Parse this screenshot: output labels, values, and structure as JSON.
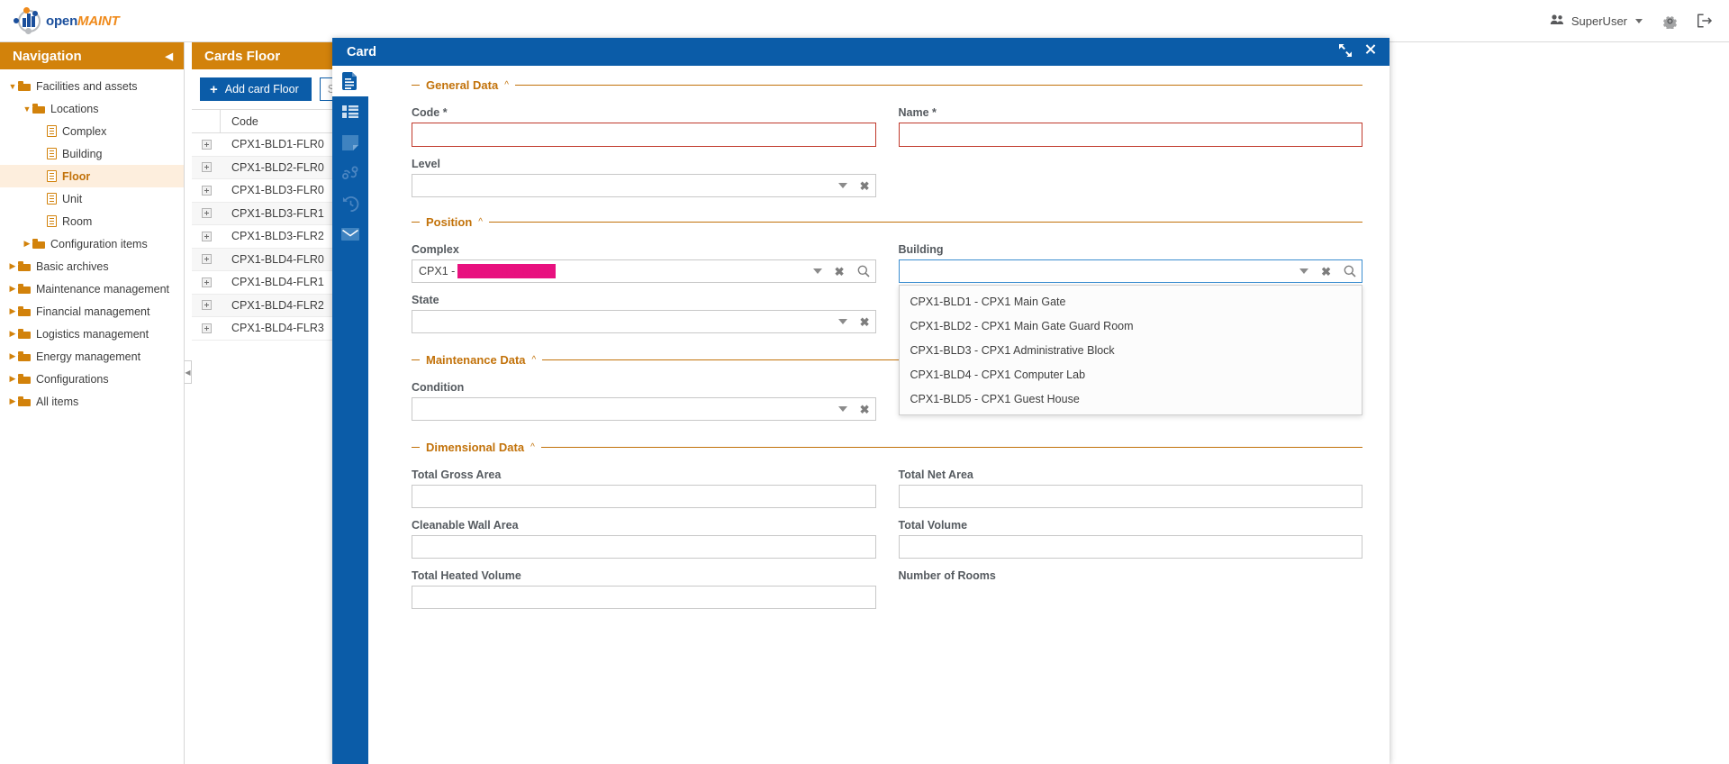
{
  "topbar": {
    "logo_open": "open",
    "logo_maint": "MAINT",
    "user": "SuperUser",
    "icons": {
      "users": "users-icon",
      "settings": "gear-icon",
      "logout": "logout-icon"
    }
  },
  "navigation": {
    "title": "Navigation",
    "collapse_icon": "collapse-left-icon",
    "items": [
      {
        "label": "Facilities and assets",
        "type": "folder",
        "indent": 0,
        "expanded": true,
        "active": false
      },
      {
        "label": "Locations",
        "type": "folder",
        "indent": 1,
        "expanded": true,
        "active": false
      },
      {
        "label": "Complex",
        "type": "doc",
        "indent": 2,
        "expanded": null,
        "active": false
      },
      {
        "label": "Building",
        "type": "doc",
        "indent": 2,
        "expanded": null,
        "active": false
      },
      {
        "label": "Floor",
        "type": "doc",
        "indent": 2,
        "expanded": null,
        "active": true
      },
      {
        "label": "Unit",
        "type": "doc",
        "indent": 2,
        "expanded": null,
        "active": false
      },
      {
        "label": "Room",
        "type": "doc",
        "indent": 2,
        "expanded": null,
        "active": false
      },
      {
        "label": "Configuration items",
        "type": "folder",
        "indent": 1,
        "expanded": false,
        "active": false
      },
      {
        "label": "Basic archives",
        "type": "folder",
        "indent": 0,
        "expanded": false,
        "active": false
      },
      {
        "label": "Maintenance management",
        "type": "folder",
        "indent": 0,
        "expanded": false,
        "active": false
      },
      {
        "label": "Financial management",
        "type": "folder",
        "indent": 0,
        "expanded": false,
        "active": false
      },
      {
        "label": "Logistics management",
        "type": "folder",
        "indent": 0,
        "expanded": false,
        "active": false
      },
      {
        "label": "Energy management",
        "type": "folder",
        "indent": 0,
        "expanded": false,
        "active": false
      },
      {
        "label": "Configurations",
        "type": "folder",
        "indent": 0,
        "expanded": false,
        "active": false
      },
      {
        "label": "All items",
        "type": "folder",
        "indent": 0,
        "expanded": false,
        "active": false
      }
    ]
  },
  "cards": {
    "title": "Cards Floor",
    "add_button": "Add card Floor",
    "search_placeholder": "Search...",
    "column_header": "Code",
    "rows": [
      "CPX1-BLD1-FLR0",
      "CPX1-BLD2-FLR0",
      "CPX1-BLD3-FLR0",
      "CPX1-BLD3-FLR1",
      "CPX1-BLD3-FLR2",
      "CPX1-BLD4-FLR0",
      "CPX1-BLD4-FLR1",
      "CPX1-BLD4-FLR2",
      "CPX1-BLD4-FLR3"
    ]
  },
  "card_modal": {
    "title": "Card",
    "expand_icon": "expand-icon",
    "close_icon": "close-icon",
    "rail": [
      {
        "name": "card-details-icon",
        "active": true
      },
      {
        "name": "details-list-icon",
        "active": false
      },
      {
        "name": "notes-icon",
        "active": false
      },
      {
        "name": "relations-icon",
        "active": false
      },
      {
        "name": "history-icon",
        "active": false
      },
      {
        "name": "email-icon",
        "active": false
      }
    ],
    "sections": {
      "general": {
        "title": "General Data",
        "code_label": "Code *",
        "code_value": "",
        "name_label": "Name *",
        "name_value": "",
        "level_label": "Level",
        "level_value": ""
      },
      "position": {
        "title": "Position",
        "complex_label": "Complex",
        "complex_value": "CPX1 - ",
        "complex_redacted": "REDACTEDNAME",
        "building_label": "Building",
        "building_value": "",
        "state_label": "State",
        "state_value": "",
        "building_options": [
          "CPX1-BLD1 - CPX1 Main Gate",
          "CPX1-BLD2 - CPX1 Main Gate Guard Room",
          "CPX1-BLD3 - CPX1 Administrative Block",
          "CPX1-BLD4 - CPX1 Computer Lab",
          "CPX1-BLD5 - CPX1 Guest House"
        ]
      },
      "maintenance": {
        "title": "Maintenance Data",
        "condition_label": "Condition",
        "condition_value": ""
      },
      "dimensional": {
        "title": "Dimensional Data",
        "total_gross_area_label": "Total Gross Area",
        "total_gross_area_value": "",
        "total_net_area_label": "Total Net Area",
        "total_net_area_value": "",
        "cleanable_wall_area_label": "Cleanable Wall Area",
        "cleanable_wall_area_value": "",
        "total_volume_label": "Total Volume",
        "total_volume_value": "",
        "total_heated_volume_label": "Total Heated Volume",
        "total_heated_volume_value": "",
        "number_of_rooms_label": "Number of Rooms",
        "number_of_rooms_value": ""
      }
    }
  },
  "colors": {
    "orange": "#d2820b",
    "blue": "#0b5ca8",
    "required_red": "#c0392b",
    "redact_pink": "#e8117f"
  }
}
